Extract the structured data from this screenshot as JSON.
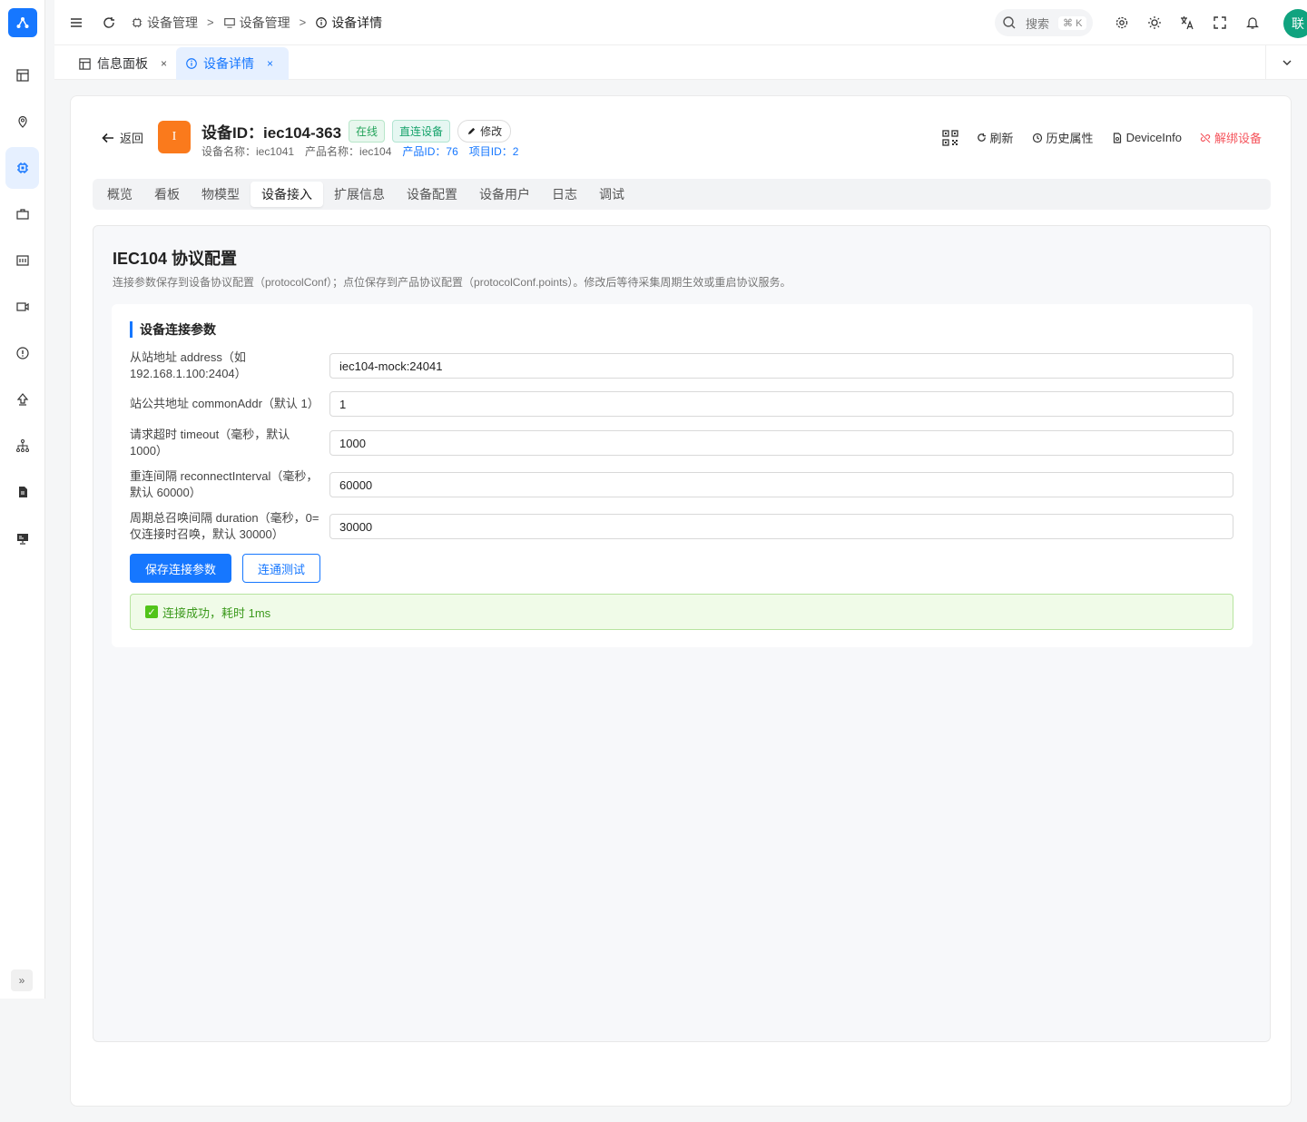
{
  "breadcrumb": [
    "设备管理",
    "设备管理",
    "设备详情"
  ],
  "search": {
    "label": "搜索",
    "shortcut": "⌘ K"
  },
  "user": {
    "avatar_text": "联"
  },
  "tabs": [
    {
      "label": "信息面板",
      "close": "×"
    },
    {
      "label": "设备详情",
      "close": "×"
    }
  ],
  "device": {
    "back_label": "返回",
    "avatar_letter": "I",
    "title": "设备ID：iec104-363",
    "status_tag": "在线",
    "type_tag": "直连设备",
    "edit_label": "修改",
    "device_name": "设备名称：iec1041",
    "product_name": "产品名称：iec104",
    "product_id": "产品ID：76",
    "project_id": "项目ID：2"
  },
  "actions": {
    "refresh": "刷新",
    "history": "历史属性",
    "deviceinfo": "DeviceInfo",
    "unbind": "解绑设备"
  },
  "subtabs": [
    "概览",
    "看板",
    "物模型",
    "设备接入",
    "扩展信息",
    "设备配置",
    "设备用户",
    "日志",
    "调试"
  ],
  "active_subtab": "设备接入",
  "panel": {
    "title": "IEC104 协议配置",
    "description": "连接参数保存到设备协议配置（protocolConf）；点位保存到产品协议配置（protocolConf.points）。修改后等待采集周期生效或重启协议服务。",
    "section_title": "设备连接参数",
    "fields": [
      {
        "label": "从站地址 address（如 192.168.1.100:2404）",
        "value": "iec104-mock:24041"
      },
      {
        "label": "站公共地址 commonAddr（默认 1）",
        "value": "1"
      },
      {
        "label": "请求超时 timeout（毫秒，默认 1000）",
        "value": "1000"
      },
      {
        "label": "重连间隔 reconnectInterval（毫秒，默认 60000）",
        "value": "60000"
      },
      {
        "label": "周期总召唤间隔 duration（毫秒，0=仅连接时召唤，默认 30000）",
        "value": "30000"
      }
    ],
    "save_label": "保存连接参数",
    "test_label": "连通测试",
    "result_text": "连接成功，耗时 1ms"
  },
  "colors": {
    "primary": "#1677ff",
    "success": "#52c41a",
    "danger": "#f5555d",
    "device_avatar": "#fa7a1c"
  }
}
